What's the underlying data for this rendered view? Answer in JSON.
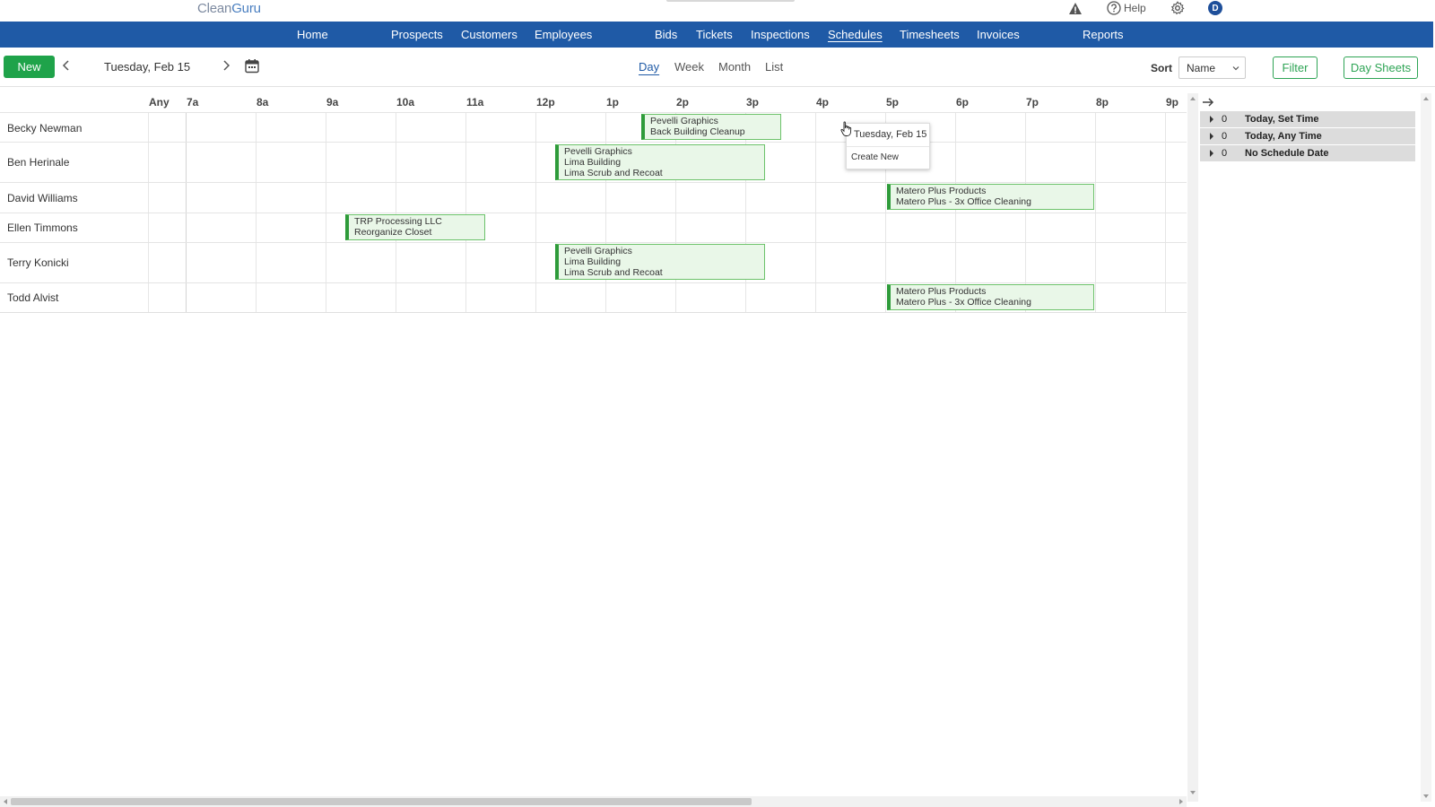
{
  "app": {
    "logo_part1": "Clean",
    "logo_part2": "Guru"
  },
  "top_icons": {
    "help_label": "Help",
    "avatar_initial": "D"
  },
  "nav": {
    "items": [
      {
        "label": "Home"
      },
      {
        "label": "Prospects"
      },
      {
        "label": "Customers"
      },
      {
        "label": "Employees"
      },
      {
        "label": "Bids"
      },
      {
        "label": "Tickets"
      },
      {
        "label": "Inspections"
      },
      {
        "label": "Schedules"
      },
      {
        "label": "Timesheets"
      },
      {
        "label": "Invoices"
      },
      {
        "label": "Reports"
      }
    ],
    "active": "Schedules"
  },
  "toolbar": {
    "new_label": "New",
    "date": "Tuesday, Feb 15",
    "views": [
      "Day",
      "Week",
      "Month",
      "List"
    ],
    "active_view": "Day",
    "sort_label": "Sort",
    "sort_value": "Name",
    "filter_label": "Filter",
    "day_sheets_label": "Day Sheets"
  },
  "grid": {
    "hours": [
      "Any",
      "7a",
      "8a",
      "9a",
      "10a",
      "11a",
      "12p",
      "1p",
      "2p",
      "3p",
      "4p",
      "5p",
      "6p",
      "7p",
      "8p",
      "9p"
    ],
    "employees": [
      {
        "name": "Becky Newman"
      },
      {
        "name": "Ben Herinale"
      },
      {
        "name": "David Williams"
      },
      {
        "name": "Ellen Timmons"
      },
      {
        "name": "Terry Konicki"
      },
      {
        "name": "Todd Alvist"
      }
    ],
    "events": [
      {
        "lines": [
          "Pevelli Graphics",
          "Back Building Cleanup"
        ]
      },
      {
        "lines": [
          "Pevelli Graphics",
          "Lima Building",
          "Lima Scrub and Recoat"
        ]
      },
      {
        "lines": [
          "Matero Plus Products",
          "Matero Plus - 3x Office Cleaning"
        ]
      },
      {
        "lines": [
          "TRP Processing LLC",
          "Reorganize Closet"
        ]
      },
      {
        "lines": [
          "Pevelli Graphics",
          "Lima Building",
          "Lima Scrub and Recoat"
        ]
      },
      {
        "lines": [
          "Matero Plus Products",
          "Matero Plus - 3x Office Cleaning"
        ]
      }
    ]
  },
  "popup": {
    "title": "Tuesday, Feb 15",
    "create_label": "Create New"
  },
  "side_panel": {
    "groups": [
      {
        "count": "0",
        "label": "Today, Set Time"
      },
      {
        "count": "0",
        "label": "Today, Any Time"
      },
      {
        "count": "0",
        "label": "No Schedule Date"
      }
    ]
  },
  "colors": {
    "nav_bg": "#1f5aa6",
    "primary_green": "#1fa34a",
    "event_fill": "#e9f7e8",
    "event_border": "#2e9b3a"
  }
}
